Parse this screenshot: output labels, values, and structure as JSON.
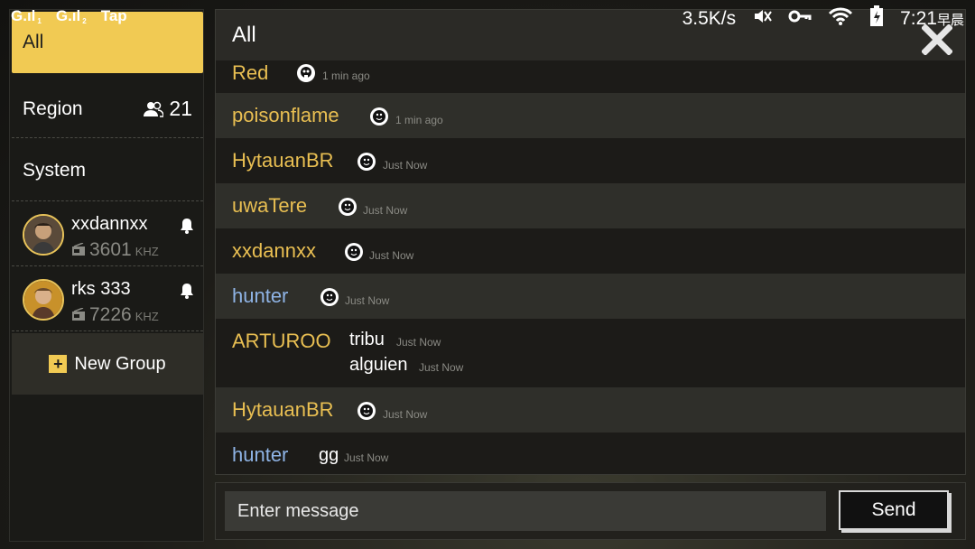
{
  "status_bar": {
    "signal1": "G.ıl",
    "signal1_sub": "1",
    "signal2": "G.ıl",
    "signal2_sub": "2",
    "app": "Tap",
    "speed": "3.5K/s",
    "time": "7:21",
    "time_suffix": "早晨"
  },
  "sidebar": {
    "all_label": "All",
    "region_label": "Region",
    "region_count": "21",
    "system_label": "System",
    "users": [
      {
        "name": "xxdannxx",
        "freq": "3601",
        "unit": "KHZ"
      },
      {
        "name": "rks 333",
        "freq": "7226",
        "unit": "KHZ"
      }
    ],
    "new_group_label": "New Group"
  },
  "chat": {
    "title": "All",
    "messages": [
      {
        "sender": "Red",
        "text": "",
        "emote": "skull-emote",
        "time": "1 min ago",
        "color": "#e9bf52"
      },
      {
        "sender": "poisonflame",
        "text": "",
        "emote": "smiley-emote",
        "time": "1 min ago",
        "color": "#e9bf52"
      },
      {
        "sender": "HytauanBR",
        "text": "",
        "emote": "smiley-emote",
        "time": "Just Now",
        "color": "#e9bf52"
      },
      {
        "sender": "uwaTere",
        "text": "",
        "emote": "smiley-emote",
        "time": "Just Now",
        "color": "#e9bf52"
      },
      {
        "sender": "xxdannxx",
        "text": "",
        "emote": "smiley-emote",
        "time": "Just Now",
        "color": "#e9bf52"
      },
      {
        "sender": "hunter",
        "text": "",
        "emote": "smiley-emote",
        "time": "Just Now",
        "color": "#8fb4e6"
      },
      {
        "sender": "ARTUROO",
        "lines": [
          {
            "text": "tribu",
            "time": "Just Now"
          },
          {
            "text": "alguien",
            "time": "Just Now"
          }
        ],
        "color": "#e9bf52"
      },
      {
        "sender": "HytauanBR",
        "text": "",
        "emote": "smiley-emote",
        "time": "Just Now",
        "color": "#e9bf52"
      },
      {
        "sender": "hunter",
        "text": "gg",
        "time": "Just Now",
        "color": "#8fb4e6"
      }
    ]
  },
  "input": {
    "placeholder": "Enter message",
    "value": "",
    "send_label": "Send"
  },
  "colors": {
    "accent": "#f1ca53",
    "name_gold": "#e9bf52",
    "name_blue": "#8fb4e6"
  }
}
